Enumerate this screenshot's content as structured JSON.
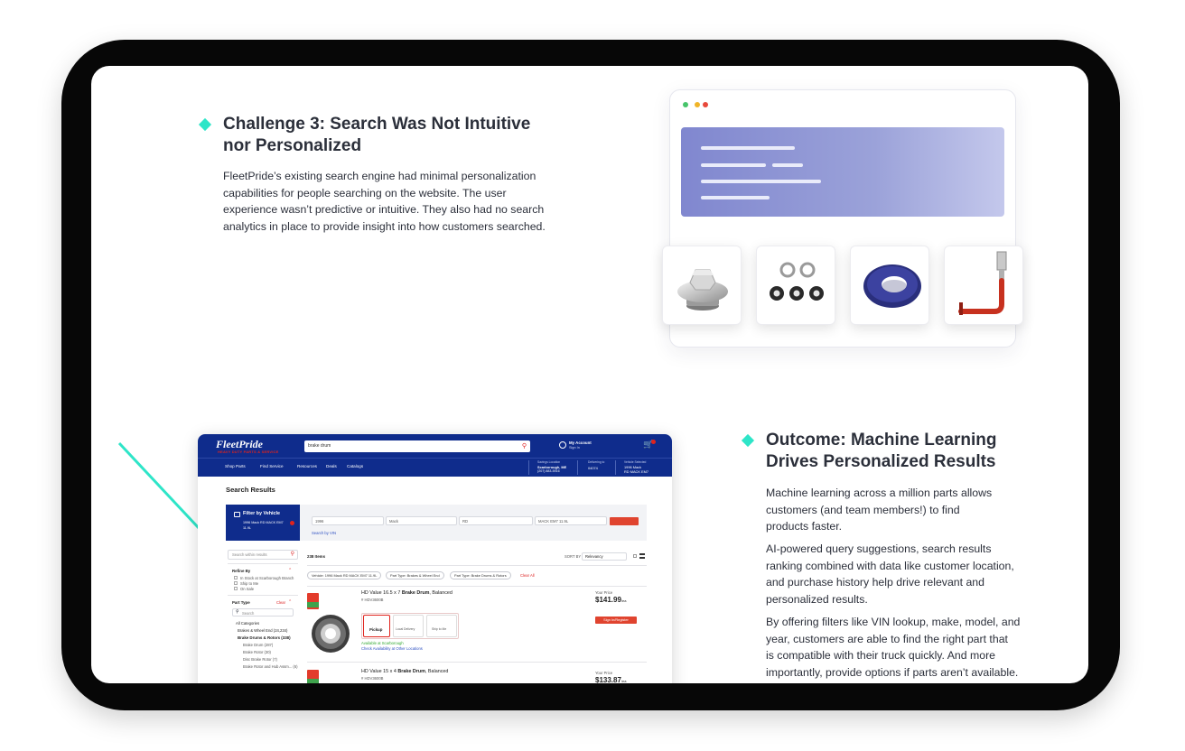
{
  "colors": {
    "accent": "#2ee5c8",
    "frame": "#070707",
    "brand_blue": "#0f2c8c",
    "brand_red": "#e0231c",
    "banner": "#8087cf"
  },
  "challenge": {
    "title_line1": "Challenge 3: Search Was Not Intuitive",
    "title_line2": "nor Personalized",
    "body": [
      "FleetPride’s existing search engine had minimal personalization",
      "capabilities for people searching on the website. The user",
      "experience wasn’t predictive or intuitive. They also had no search",
      "analytics in place to provide insight into how customers searched."
    ]
  },
  "outcome": {
    "title_line1": "Outcome: Machine Learning",
    "title_line2": "Drives Personalized Results",
    "para1": [
      "Machine learning across a million parts allows",
      "customers (and team members!) to find",
      "products faster."
    ],
    "para2": [
      "AI-powered query suggestions, search results",
      "ranking combined with data like customer location,",
      "and purchase history help drive relevant and",
      "personalized results."
    ],
    "para3": [
      "By offering filters like VIN lookup, make, model, and",
      "year, customers are able to find the right part that",
      "is compatible with their truck quickly. And more",
      "importantly, provide options if parts aren’t available."
    ]
  },
  "illustration": {
    "icons": [
      "bolt-nut-icon",
      "washers-icon",
      "oring-icon",
      "hose-fitting-icon"
    ]
  },
  "screenshot": {
    "logo": "FleetPride",
    "logo_sub": "HEAVY DUTY PARTS & SERVICE",
    "search_value": "brake drum",
    "account": "My Account",
    "sign_in": "Sign In",
    "menu": [
      "Shop Parts",
      "Find Service",
      "Resources",
      "Deals",
      "Catalogs"
    ],
    "store_label": "Savings Location",
    "store_name": "Scarborough, ME",
    "store_phone": "(207) 883-5916",
    "delivery_label": "Delivering to",
    "delivery_zip": "04074",
    "vehicle_label": "Vehicle Selected",
    "vehicle_line1": "1996 Mack",
    "vehicle_line2": "RD MACK EM7",
    "page_title": "Search Results",
    "filter_title": "Filter by Vehicle",
    "filter_sub": "1996 Mack RD MACK EM7 11.9L",
    "selects": [
      "1996",
      "Mack",
      "RD",
      "MACK EM7 11.9L"
    ],
    "vin_link": "Search by VIN",
    "search_within": "Search within results",
    "refine_by": "Refine By",
    "refine_opts": [
      "In Stock at Scarborough Branch",
      "Ship to Me",
      "On Sale"
    ],
    "part_type": "Part Type",
    "clear": "Clear",
    "search_ph": "Search",
    "categories": [
      "All Categories",
      "Brakes & Wheel End (24,234)",
      "Brake Drums & Rotors (338)",
      "Brake Drum (287)",
      "Brake Rotor (30)",
      "Disc Brake Rotor (7)",
      "Brake Rotor and Hub Assm... (6)"
    ],
    "item_count": "238 Items",
    "sort_label": "SORT BY",
    "sort_value": "Relevancy",
    "chips": [
      "Vehicle: 1996 Mack RD MACK EM7 11.9L",
      "Part Type: Brakes & Wheel End",
      "Part Type: Brake Drums & Rotors",
      "Clear All"
    ],
    "products": [
      {
        "name_pre": "HD Value 16.5 x 7 ",
        "name_bold": "Brake Drum",
        "name_post": ", Balanced",
        "sku": "# HDV3600B",
        "price_label": "Your Price",
        "price": "$141.99",
        "unit": "/ea",
        "button": "Sign In/Register",
        "options": [
          "Pickup",
          "Local Delivery",
          "Ship to Me"
        ],
        "availability": "Available at Scarborough",
        "check": "Check Availability at Other Locations"
      },
      {
        "name_pre": "HD Value 15 x 4 ",
        "name_bold": "Brake Drum",
        "name_post": ", Balanced",
        "sku": "# HDV3600B",
        "price_label": "Your Price",
        "price": "$133.87",
        "unit": "/ea"
      }
    ]
  }
}
